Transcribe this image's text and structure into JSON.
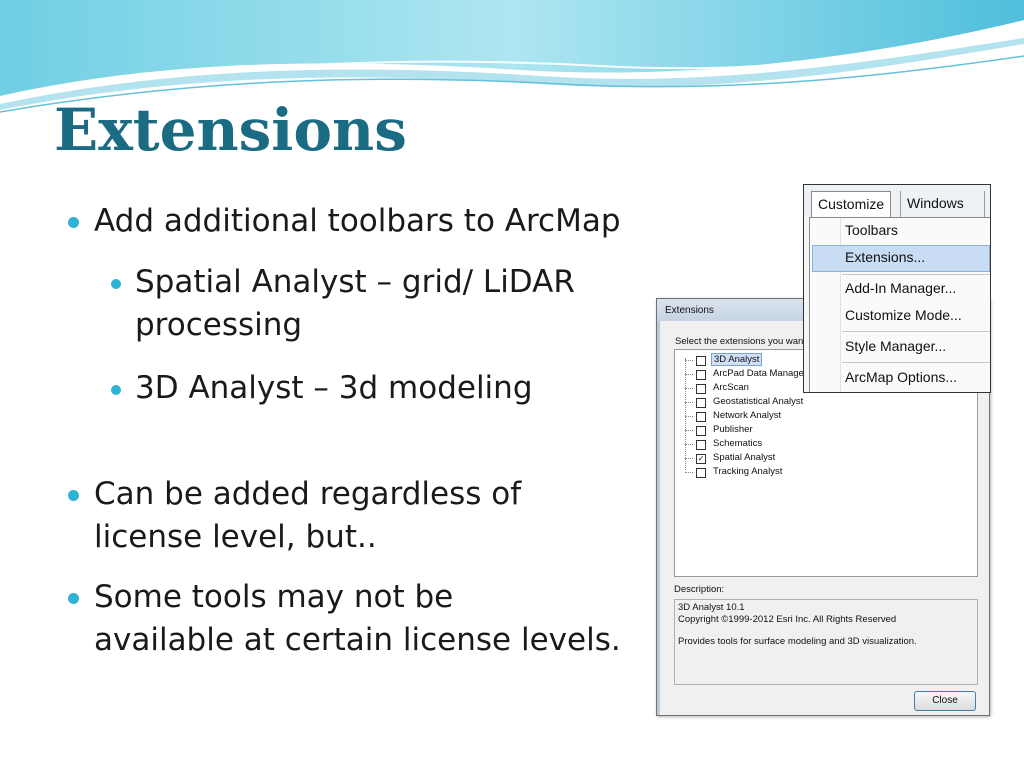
{
  "slide": {
    "title": "Extensions",
    "bullets": [
      {
        "text": "Add additional toolbars to ArcMap",
        "sub": [
          {
            "line1": "Spatial Analyst – grid/ LiDAR",
            "line2": "processing"
          },
          {
            "line1": "3D Analyst – 3d modeling"
          }
        ]
      },
      {
        "line1": "Can be added regardless of",
        "line2": "license level, but.."
      },
      {
        "line1": "Some tools may not be",
        "line2": "available at certain license levels."
      }
    ],
    "colors": {
      "title": "#1b6b82",
      "bullet": "#2fb3d4",
      "wave": "#5fc7de"
    }
  },
  "dialog": {
    "title": "Extensions",
    "prompt": "Select the extensions you want",
    "items": [
      {
        "label": "3D Analyst",
        "checked": false,
        "selected": true
      },
      {
        "label": "ArcPad Data Manager",
        "checked": false
      },
      {
        "label": "ArcScan",
        "checked": false
      },
      {
        "label": "Geostatistical Analyst",
        "checked": false
      },
      {
        "label": "Network Analyst",
        "checked": false
      },
      {
        "label": "Publisher",
        "checked": false
      },
      {
        "label": "Schematics",
        "checked": false
      },
      {
        "label": "Spatial Analyst",
        "checked": true
      },
      {
        "label": "Tracking Analyst",
        "checked": false
      }
    ],
    "description_label": "Description:",
    "description": {
      "line1": "3D Analyst 10.1",
      "line2": "Copyright ©1999-2012 Esri Inc. All Rights Reserved",
      "line3": "Provides tools for surface modeling and 3D visualization."
    },
    "close_label": "Close"
  },
  "menu": {
    "tabs": [
      "Customize",
      "Windows"
    ],
    "items": [
      "Toolbars",
      "Extensions...",
      "Add-In Manager...",
      "Customize Mode...",
      "Style Manager...",
      "ArcMap Options..."
    ],
    "highlighted": "Extensions..."
  }
}
